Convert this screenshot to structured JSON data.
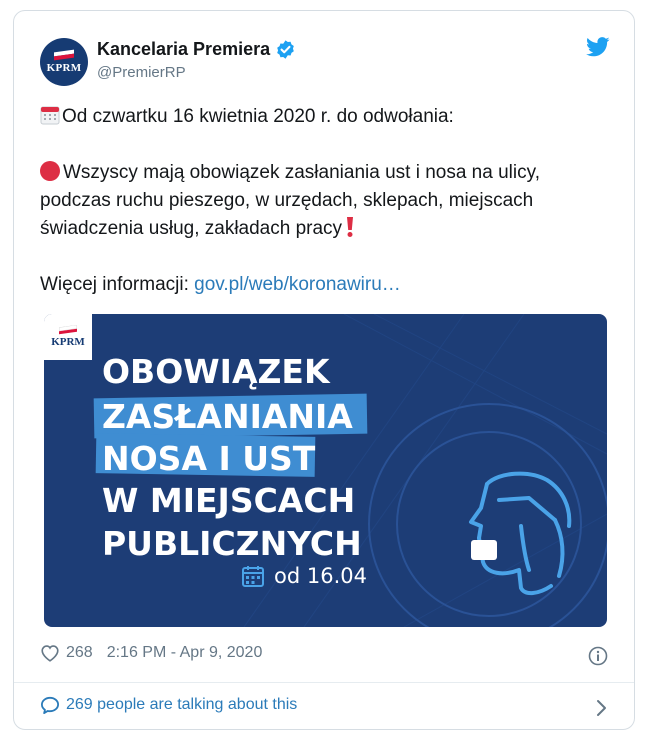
{
  "account": {
    "name": "Kancelaria Premiera",
    "handle": "@PremierRP",
    "avatar_text": "KPRM"
  },
  "tweet": {
    "line1": "Od czwartku 16 kwietnia 2020 r. do odwołania:",
    "line2": "Wszyscy mają obowiązek zasłaniania ust i nosa na ulicy, podczas ruchu pieszego, w urzędach, sklepach, miejscach świadczenia usług, zakładach pracy",
    "more_label": "Więcej informacji: ",
    "more_link": "gov.pl/web/koronawiru…"
  },
  "media": {
    "logo_text": "KPRM",
    "headline": [
      "OBOWIĄZEK",
      "ZASŁANIANIA",
      "NOSA I UST",
      "W MIEJSCACH",
      "PUBLICZNYCH"
    ],
    "date_text": "od 16.04"
  },
  "footer": {
    "likes": "268",
    "timestamp": "2:16 PM - Apr 9, 2020",
    "talking": "269 people are talking about this"
  },
  "colors": {
    "link": "#2b7bb9",
    "media_bg": "#1d3d76",
    "stripe": "#3f8dd2",
    "twitter_blue": "#1da1f2"
  },
  "icons": [
    "twitter-bird-icon",
    "verified-badge-icon",
    "calendar-emoji-icon",
    "red-circle-emoji-icon",
    "exclamation-emoji-icon",
    "heart-icon",
    "info-icon",
    "speech-bubble-icon",
    "chevron-right-icon",
    "face-mask-icon",
    "calendar-icon"
  ]
}
